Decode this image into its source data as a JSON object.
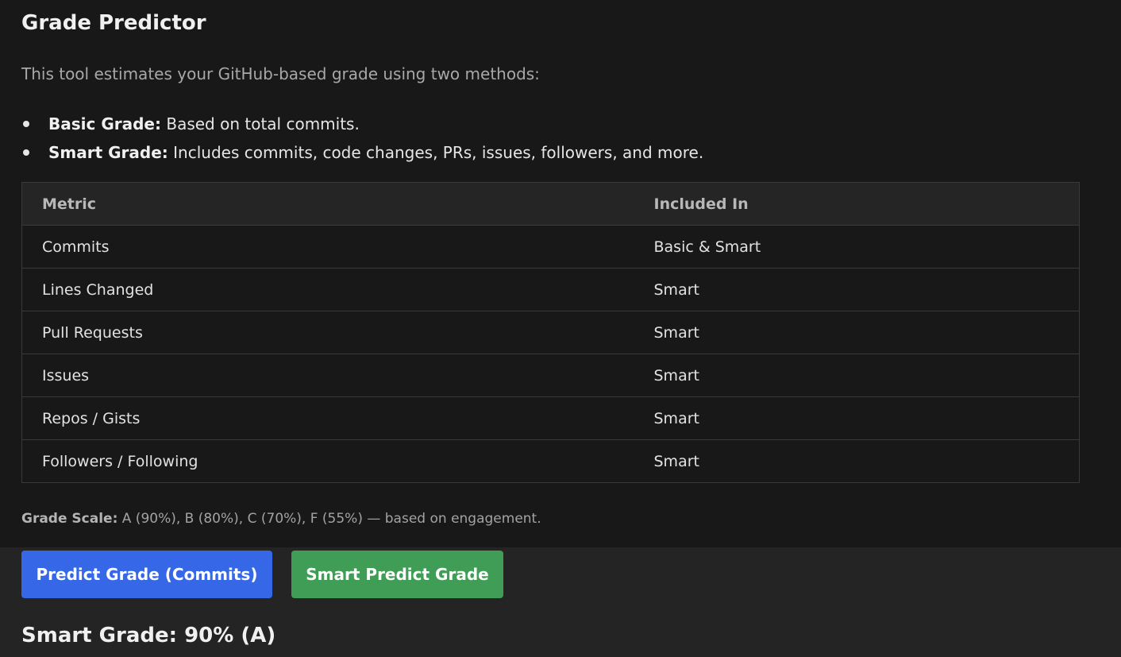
{
  "page": {
    "title": "Grade Predictor",
    "intro": "This tool estimates your GitHub-based grade using two methods:"
  },
  "methods": [
    {
      "label": "Basic Grade:",
      "text": " Based on total commits."
    },
    {
      "label": "Smart Grade:",
      "text": " Includes commits, code changes, PRs, issues, followers, and more."
    }
  ],
  "table": {
    "headers": [
      "Metric",
      "Included In"
    ],
    "rows": [
      [
        "Commits",
        "Basic & Smart"
      ],
      [
        "Lines Changed",
        "Smart"
      ],
      [
        "Pull Requests",
        "Smart"
      ],
      [
        "Issues",
        "Smart"
      ],
      [
        "Repos / Gists",
        "Smart"
      ],
      [
        "Followers / Following",
        "Smart"
      ]
    ]
  },
  "scale": {
    "label": "Grade Scale:",
    "text": " A (90%), B (80%), C (70%), F (55%) — based on engagement."
  },
  "buttons": {
    "basic_label": "Predict Grade (Commits)",
    "smart_label": "Smart Predict Grade"
  },
  "result": {
    "text": "Smart Grade: 90% (A)"
  },
  "colors": {
    "basic_button": "#3567e6",
    "smart_button": "#3f9d55",
    "background": "#181818"
  }
}
